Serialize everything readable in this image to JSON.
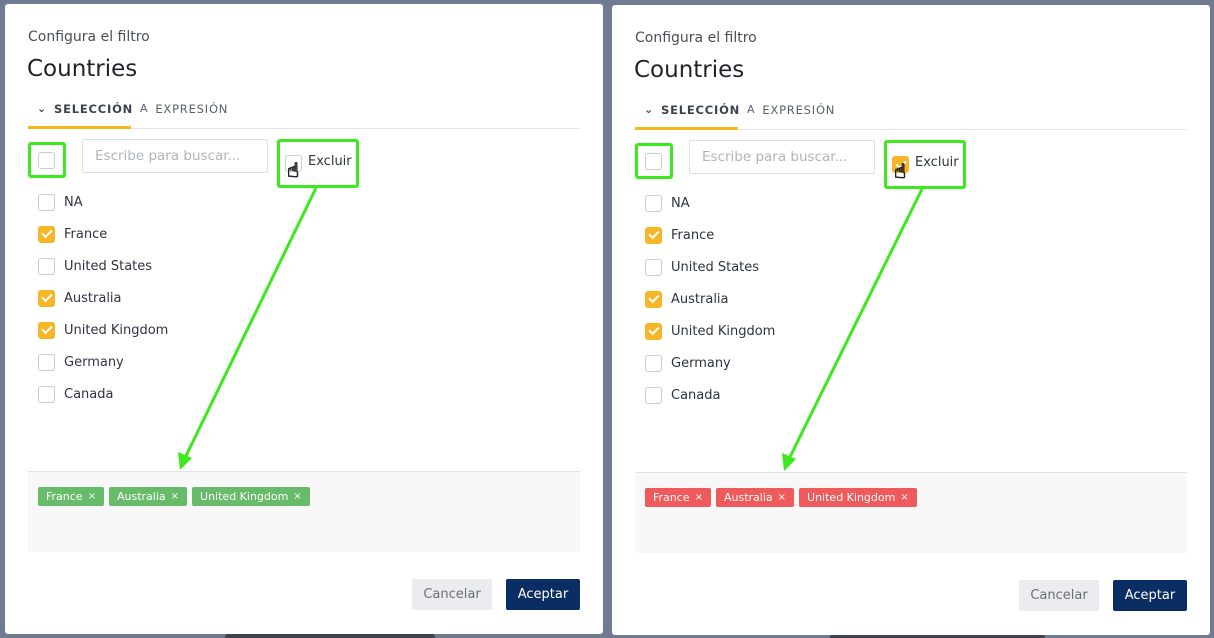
{
  "panels": [
    {
      "subtitle": "Configura el filtro",
      "title": "Countries",
      "tabs": [
        {
          "label": "SELECCIÓN",
          "icon": "chevron-down-icon",
          "active": true
        },
        {
          "label": "EXPRESIÓN",
          "icon": "text-a-icon",
          "active": false
        }
      ],
      "search_placeholder": "Escribe para buscar...",
      "exclude": {
        "label": "Excluir",
        "checked": false
      },
      "items": [
        {
          "label": "NA",
          "checked": false
        },
        {
          "label": "France",
          "checked": true
        },
        {
          "label": "United States",
          "checked": false
        },
        {
          "label": "Australia",
          "checked": true
        },
        {
          "label": "United Kingdom",
          "checked": true
        },
        {
          "label": "Germany",
          "checked": false
        },
        {
          "label": "Canada",
          "checked": false
        }
      ],
      "chips": [
        "France",
        "Australia",
        "United Kingdom"
      ],
      "chip_color": "#67bb6a",
      "chip_remove": "×",
      "buttons": {
        "cancel": "Cancelar",
        "accept": "Aceptar"
      }
    },
    {
      "subtitle": "Configura el filtro",
      "title": "Countries",
      "tabs": [
        {
          "label": "SELECCIÓN",
          "icon": "chevron-down-icon",
          "active": true
        },
        {
          "label": "EXPRESIÓN",
          "icon": "text-a-icon",
          "active": false
        }
      ],
      "search_placeholder": "Escribe para buscar...",
      "exclude": {
        "label": "Excluir",
        "checked": true
      },
      "items": [
        {
          "label": "NA",
          "checked": false
        },
        {
          "label": "France",
          "checked": true
        },
        {
          "label": "United States",
          "checked": false
        },
        {
          "label": "Australia",
          "checked": true
        },
        {
          "label": "United Kingdom",
          "checked": true
        },
        {
          "label": "Germany",
          "checked": false
        },
        {
          "label": "Canada",
          "checked": false
        }
      ],
      "chips": [
        "France",
        "Australia",
        "United Kingdom"
      ],
      "chip_color": "#ef5a5c",
      "chip_remove": "×",
      "buttons": {
        "cancel": "Cancelar",
        "accept": "Aceptar"
      }
    }
  ],
  "icons": {
    "chevron": "⌄",
    "text_a": "A",
    "hand": "☝"
  },
  "annotation_color": "#3ee81e"
}
